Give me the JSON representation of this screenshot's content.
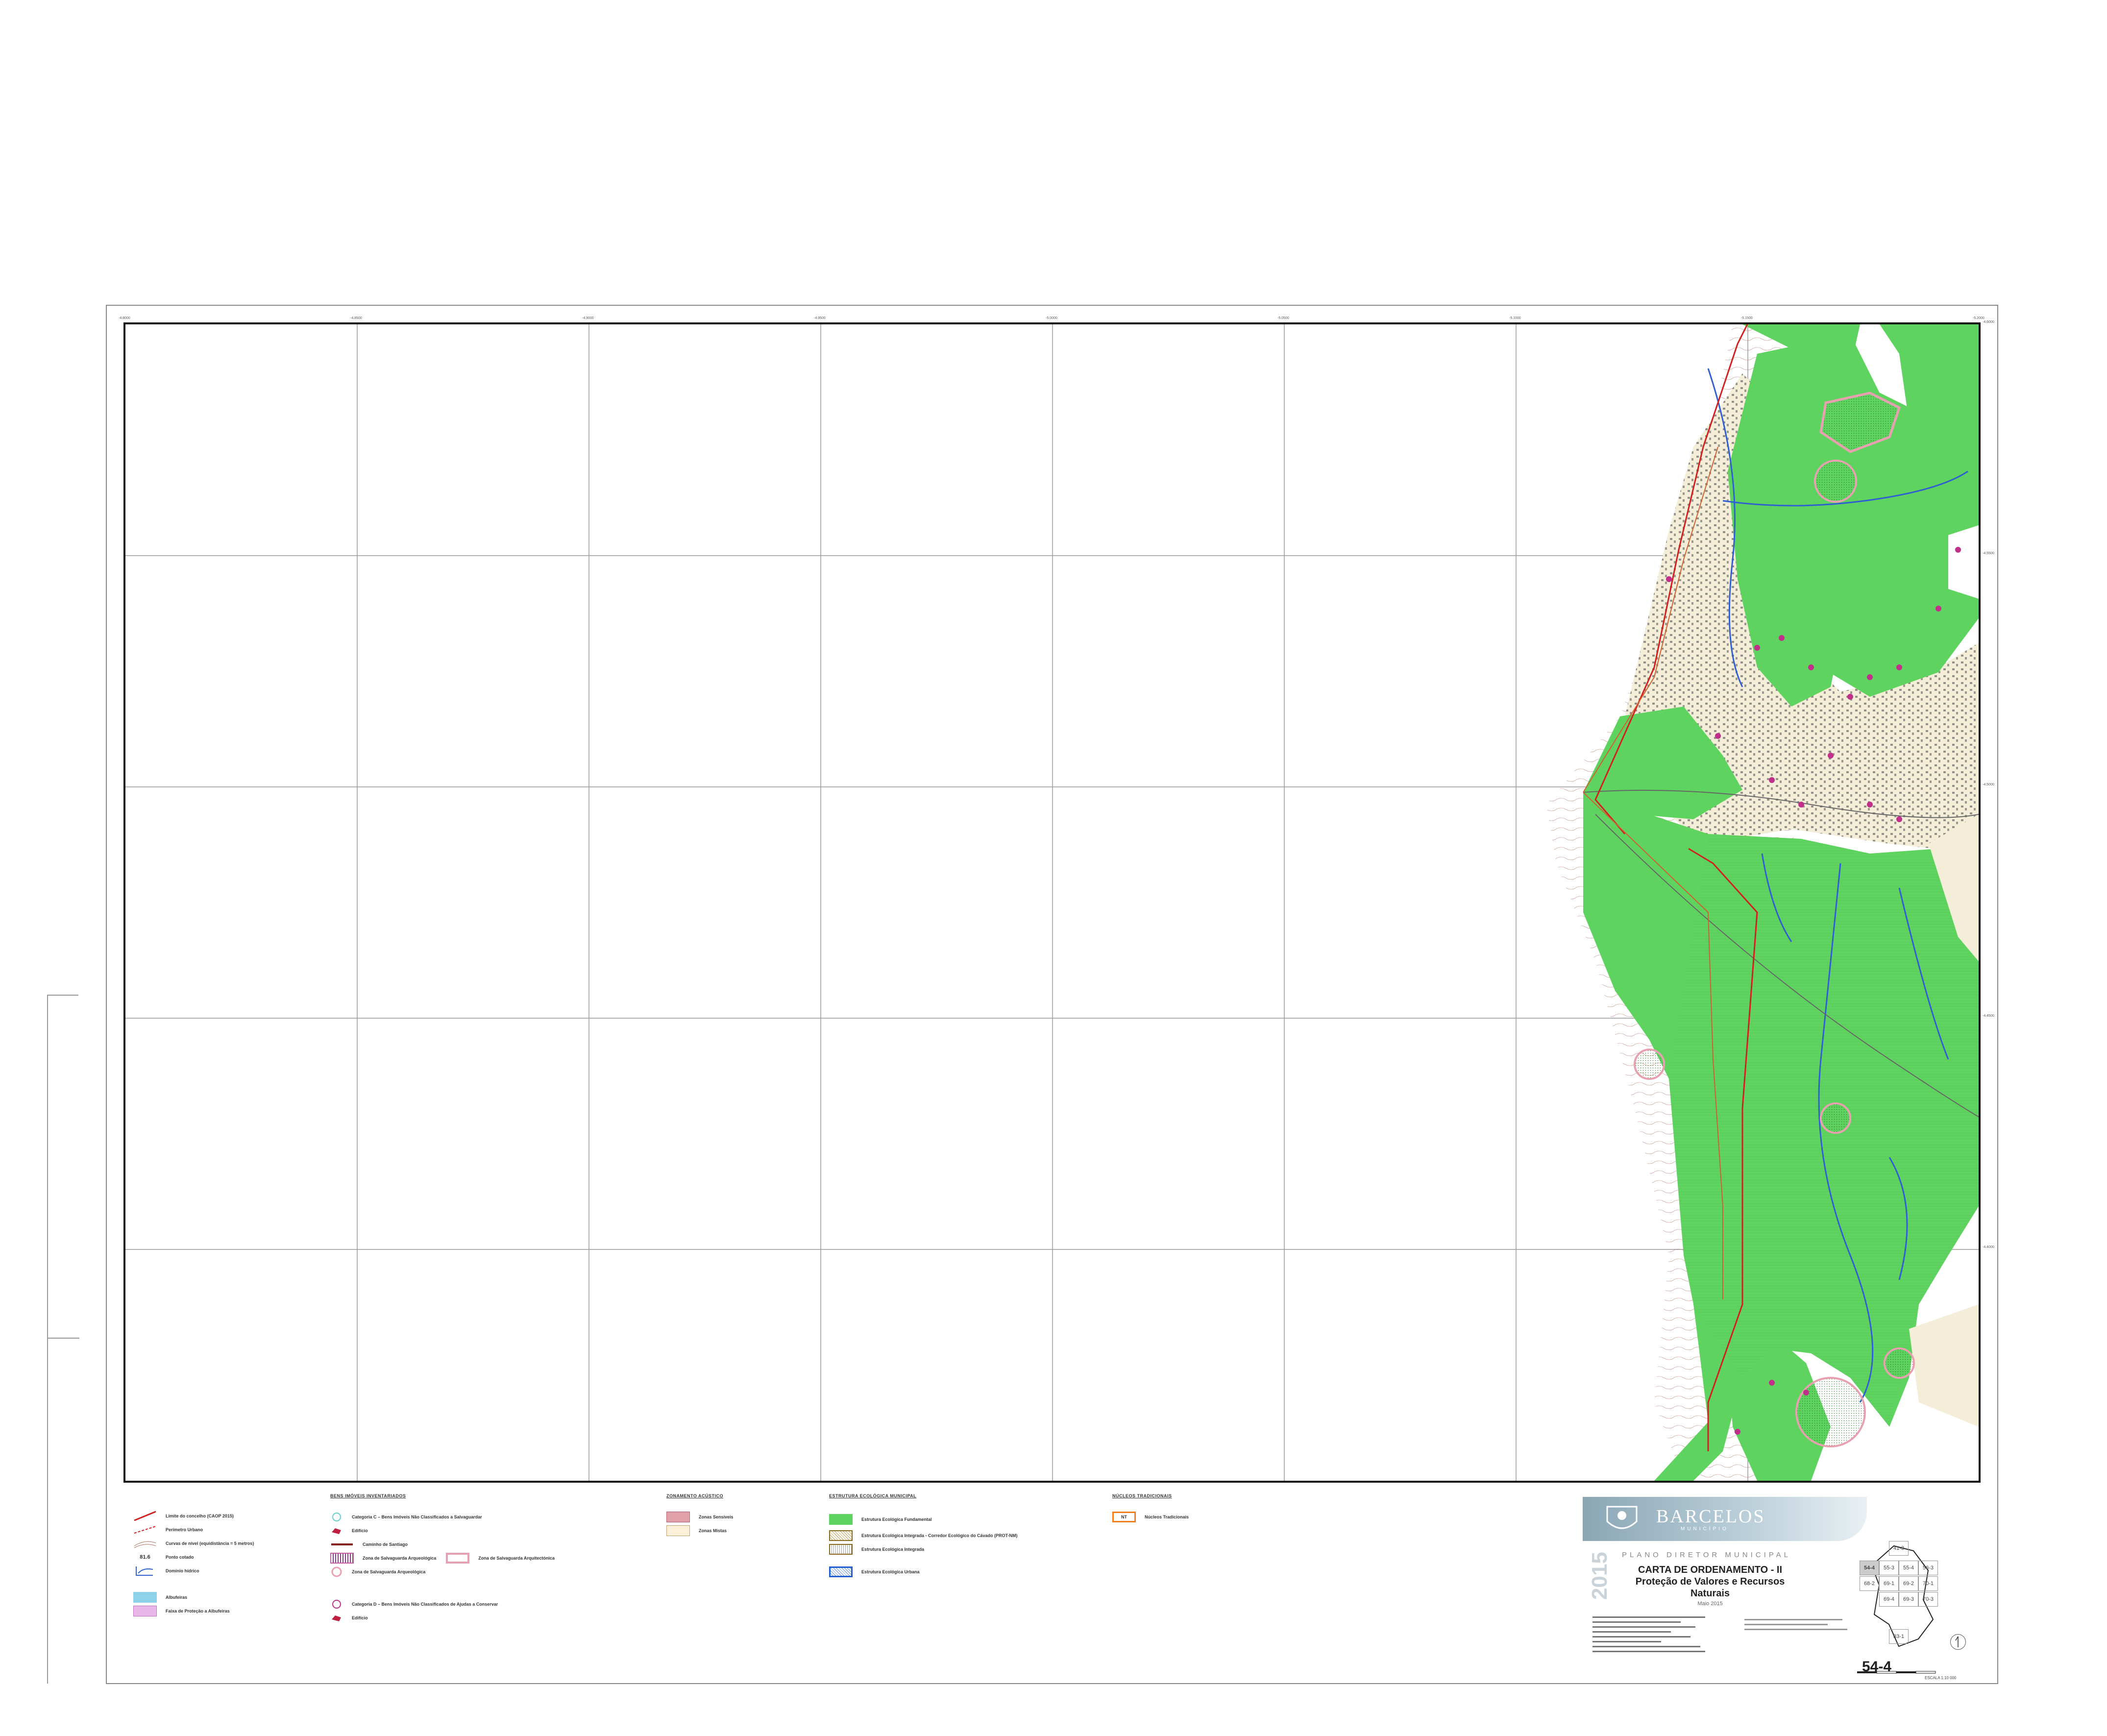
{
  "map": {
    "coords_top": [
      "-4.8000",
      "-4.8500",
      "-4.9000",
      "-4.9500",
      "-5.0000",
      "-5.0500",
      "-5.1000",
      "-5.1500",
      "-5.2000"
    ],
    "coords_right": [
      "-4.6000",
      "-4.5500",
      "-4.5000",
      "-4.4500",
      "-4.4000"
    ],
    "colors": {
      "eef": "#5fd35f",
      "urban_tint": "#f4edd8",
      "contour": "#b07060",
      "river": "#2f5fd0",
      "boundary": "#d02020",
      "pink": "#f0a8b8",
      "magenta": "#c0308a"
    }
  },
  "legend": {
    "col1": [
      {
        "label": "Limite do concelho (CAOP 2015)",
        "icon": "red-line-icon"
      },
      {
        "label": "Perímetro Urbano",
        "icon": "red-dash-icon"
      },
      {
        "label": "Curvas de nível (equidistância = 5 metros)",
        "icon": "contour-icon"
      },
      {
        "label": "Ponto cotado",
        "icon": "spot-height-icon",
        "sample": "81.6"
      },
      {
        "label": "Domínio hídrico",
        "icon": "hydro-icon"
      },
      {
        "label": "Albufeiras",
        "icon": "reservoir-icon"
      },
      {
        "label": "Faixa de Proteção a Albufeiras",
        "icon": "protection-icon"
      }
    ],
    "col2_head": "BENS IMÓVEIS INVENTARIADOS",
    "col2_cat_c": "Categoria C – Bens Imóveis Não Classificados a Salvaguardar",
    "col2_edificio_c": "Edifício",
    "col2_caminho": "Caminho de Santiago",
    "col2_zona_arq": "Zona de Salvaguarda Arqueológica",
    "col2_zona_arqt": "Zona de Salvaguarda Arquitectónica",
    "col2_zona_arq2": "Zona de Salvaguarda Arqueológica",
    "col2_cat_d": "Categoria D – Bens Imóveis Não Classificados de Ajudas a Conservar",
    "col2_edificio_d": "Edifício",
    "col3_head": "ZONAMENTO ACÚSTICO",
    "col3_items": [
      "Zonas Sensíveis",
      "Zonas Mistas"
    ],
    "col3_colors": [
      "#e0a0a8",
      "#fbf0d8"
    ],
    "col4_head": "ESTRUTURA ECOLÓGICA MUNICIPAL",
    "col4_items": [
      "Estrutura Ecológica Fundamental",
      "Estrutura Ecológica Integrada - Corredor Ecológico do Cávado (PROT-NM)",
      "Estrutura Ecológica Integrada",
      "Estrutura Ecológica Urbana"
    ],
    "col5_head": "NÚCLEOS TRADICIONAIS",
    "col5_item": "Núcleos Tradicionais",
    "col5_code": "NT"
  },
  "title_block": {
    "brand": "BARCELOS",
    "brand_sub": "MUNICÍPIO",
    "year": "2015",
    "plan": "PLANO DIRETOR MUNICIPAL",
    "title_1": "CARTA DE ORDENAMENTO - II",
    "title_2": "Proteção de Valores e Recursos",
    "title_3": "Naturais",
    "date": "Maio 2015",
    "sheet": "54-4",
    "scale": "ESCALA 1:10 000",
    "index": [
      {
        "code": "41-3"
      },
      {
        "code": "54-4"
      },
      {
        "code": "55-3"
      },
      {
        "code": "55-4"
      },
      {
        "code": "56-3"
      },
      {
        "code": "68-2"
      },
      {
        "code": "69-1"
      },
      {
        "code": "69-2"
      },
      {
        "code": "70-1"
      },
      {
        "code": "69-4"
      },
      {
        "code": "69-3"
      },
      {
        "code": "70-3"
      },
      {
        "code": "83-1"
      }
    ]
  }
}
